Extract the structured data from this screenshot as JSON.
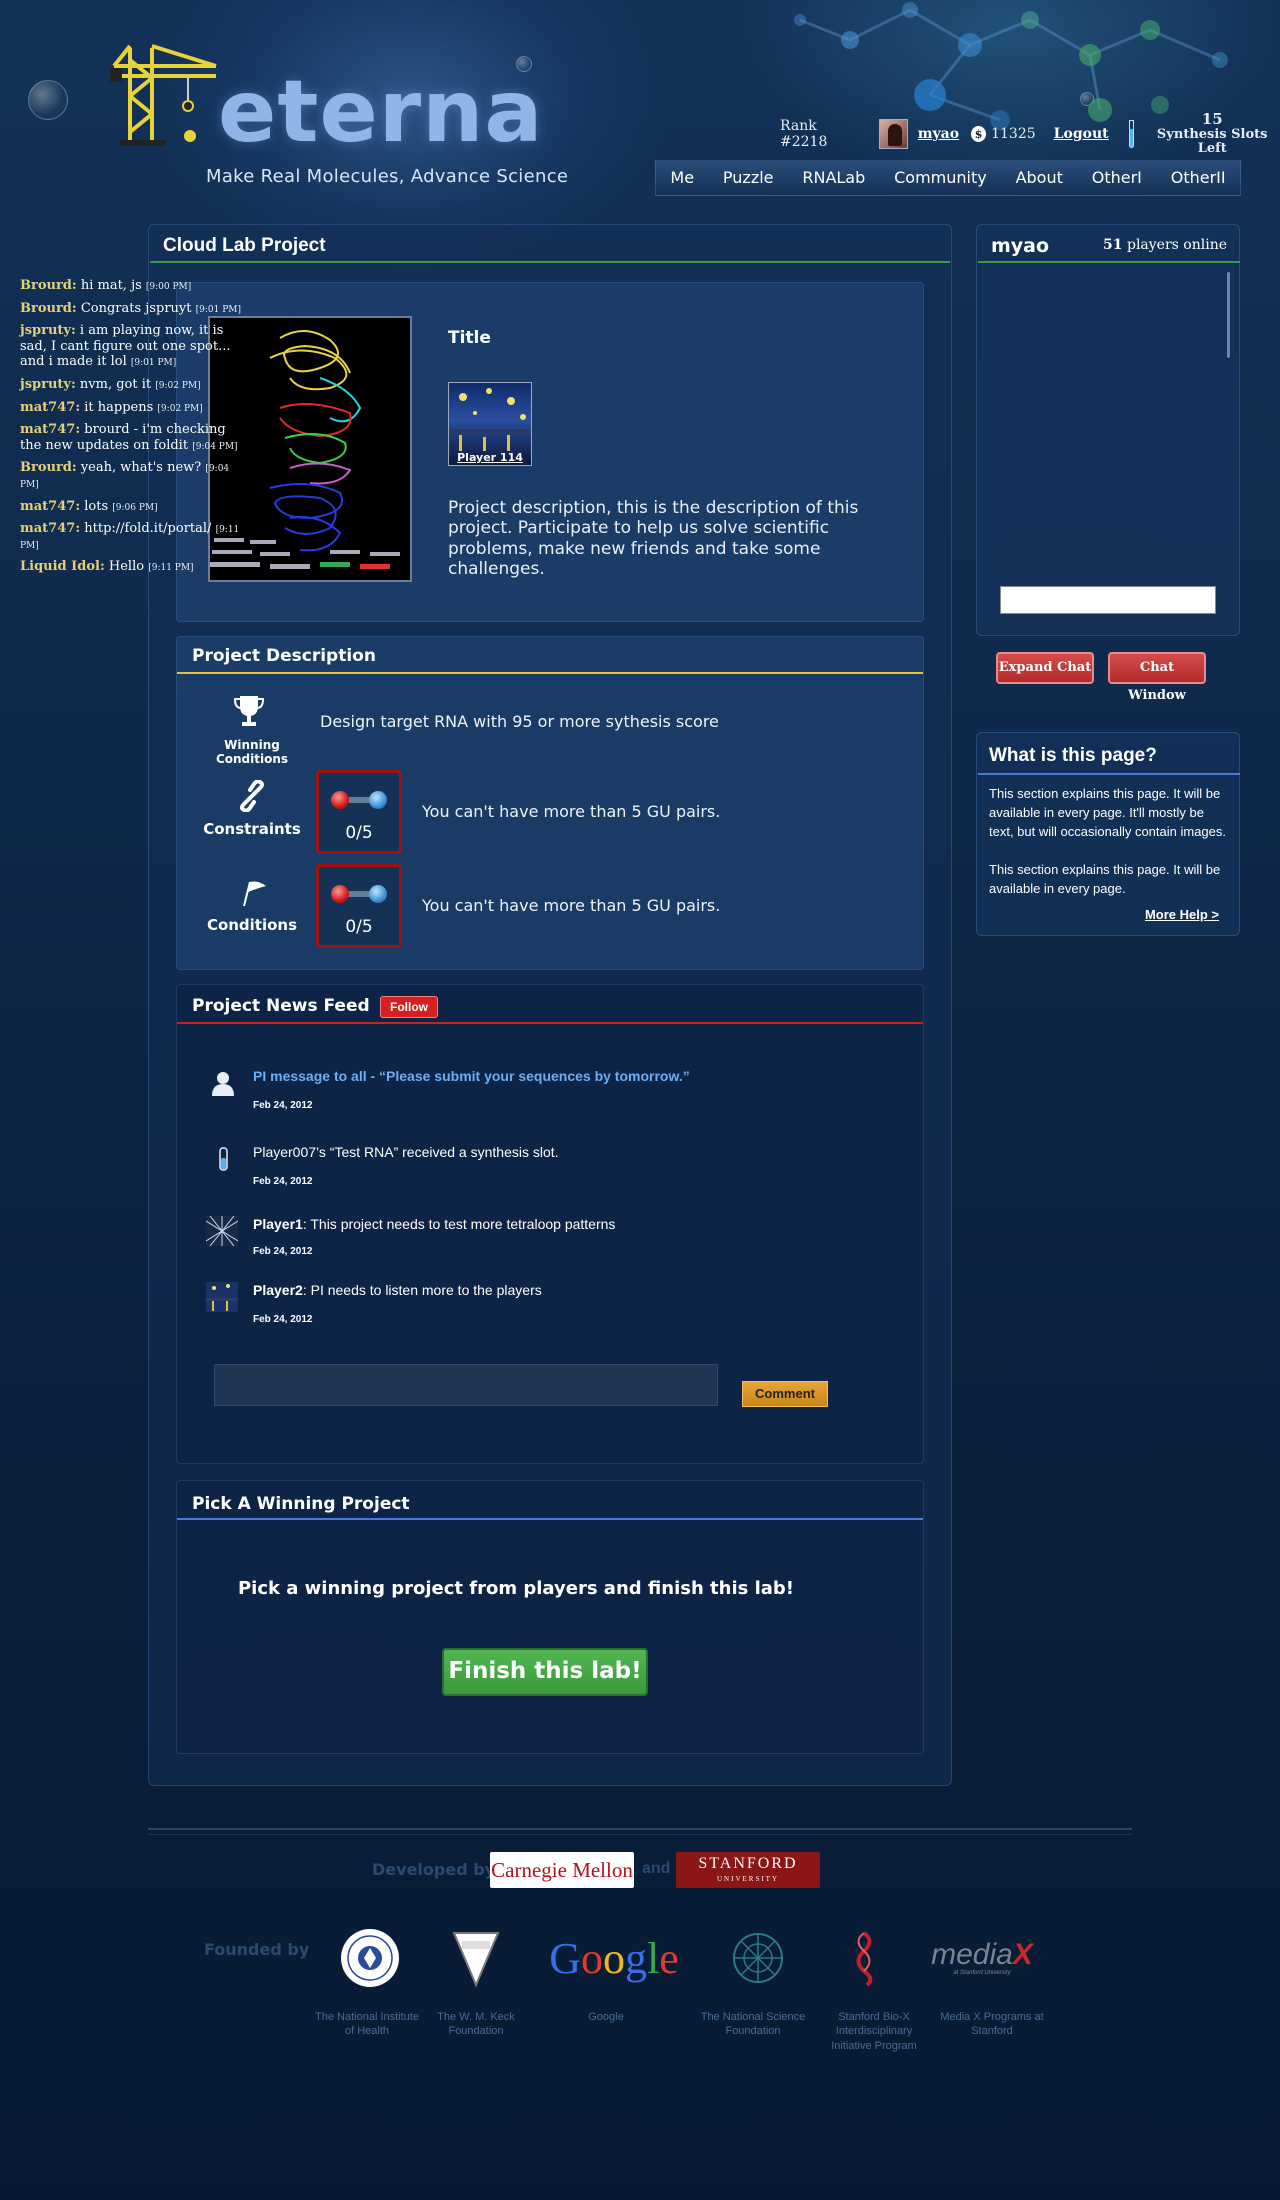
{
  "header": {
    "logo_text": "eterna",
    "tagline": "Make Real Molecules, Advance Science",
    "rank": "Rank #2218",
    "username": "myao",
    "coins": "11325",
    "logout": "Logout",
    "slots_count": "15",
    "slots_label": "Synthesis Slots Left",
    "nav": [
      "Me",
      "Puzzle",
      "RNALab",
      "Community",
      "About",
      "OtherI",
      "OtherII"
    ]
  },
  "main": {
    "title": "Cloud Lab Project",
    "project_title": "Title",
    "player_thumb_label": "Player 114",
    "project_description": "Project description, this is the description of this project. Participate to help us solve scientific problems, make new friends and take some challenges.",
    "description_section": {
      "title": "Project Description",
      "winning_label": "Winning Conditions",
      "winning_text": "Design target RNA with 95 or more sythesis score",
      "constraints_label": "Constraints",
      "constraints_count": "0/5",
      "constraints_text": "You can't have more than 5 GU pairs.",
      "conditions_label": "Conditions",
      "conditions_count": "0/5",
      "conditions_text": "You can't have more than 5 GU pairs."
    },
    "news": {
      "title": "Project News Feed",
      "follow": "Follow",
      "items": [
        {
          "author": "",
          "text": "PI message to all - “Please submit your sequences by tomorrow.”",
          "date": "Feb 24, 2012"
        },
        {
          "author": "",
          "text": "Player007’s “Test RNA” received a synthesis slot.",
          "date": "Feb 24, 2012"
        },
        {
          "author": "Player1",
          "text": ":  This project needs to test more tetraloop patterns",
          "date": "Feb 24, 2012"
        },
        {
          "author": "Player2",
          "text": ":  PI needs to listen more to the players",
          "date": "Feb 24, 2012"
        }
      ],
      "comment_button": "Comment"
    },
    "pick": {
      "title": "Pick A Winning Project",
      "text": "Pick a winning project from players and finish this lab!",
      "button": "Finish this lab!"
    }
  },
  "chat": {
    "user": "myao",
    "online_count": "51",
    "online_label": " players online",
    "messages": [
      {
        "name": "Brourd:",
        "text": " hi mat, js ",
        "time": "[9:00 PM]"
      },
      {
        "name": "Brourd:",
        "text": " Congrats jspruyt ",
        "time": "[9:01 PM]"
      },
      {
        "name": "jspruty:",
        "text": " i am playing now, it is sad, I cant figure out one spot... and i made it lol ",
        "time": "[9:01 PM]"
      },
      {
        "name": "jspruty:",
        "text": " nvm, got it ",
        "time": "[9:02 PM]"
      },
      {
        "name": "mat747:",
        "text": " it happens ",
        "time": "[9:02 PM]"
      },
      {
        "name": "mat747:",
        "text": " brourd - i'm checking the new updates on foldit ",
        "time": "[9:04 PM]"
      },
      {
        "name": "Brourd:",
        "text": " yeah, what's new? ",
        "time": "[9:04 PM]"
      },
      {
        "name": "mat747:",
        "text": " lots ",
        "time": "[9:06 PM]"
      },
      {
        "name": "mat747:",
        "text": " http://fold.it/portal/ ",
        "time": "[9:11 PM]"
      },
      {
        "name": "Liquid Idol:",
        "text": " Hello ",
        "time": "[9:11 PM]"
      }
    ],
    "expand_button": "Expand Chat",
    "window_button": "Chat Window"
  },
  "help": {
    "title": "What is this page?",
    "paragraph1": "This section explains this page. It will be available in every page. It'll mostly be text, but will occasionally contain images.",
    "paragraph2": "This section explains this page. It will be available in every page.",
    "more_link": "More Help >"
  },
  "footer": {
    "developed_by": "Developed by",
    "cmu": "Carnegie Mellon",
    "and": "and",
    "stanford": "STANFORD",
    "stanford_sub": "UNIVERSITY",
    "founded_by": "Founded by",
    "funders": [
      {
        "logo": "NATIONAL INSTITUTES OF HEALTH",
        "caption": "The National Institute of Health"
      },
      {
        "logo": "W.M. KECK FOUNDATION",
        "caption": "The W. M. Keck Foundation"
      },
      {
        "logo": "Google",
        "caption": "Google"
      },
      {
        "logo": "NSF",
        "caption": "The National Science Foundation"
      },
      {
        "logo": "BIO-X",
        "caption": "Stanford Bio-X Interdisciplinary Initiative Program"
      },
      {
        "logo": "mediaX",
        "logo_sub": "at Stanford University",
        "caption": "Media X Programs at Stanford"
      }
    ]
  },
  "colors": {
    "accent_green": "#3a9a4a",
    "accent_yellow": "#e6c23a",
    "accent_red": "#c92020",
    "accent_blue": "#4a7ad6",
    "chat_name": "#e7cf7a"
  }
}
